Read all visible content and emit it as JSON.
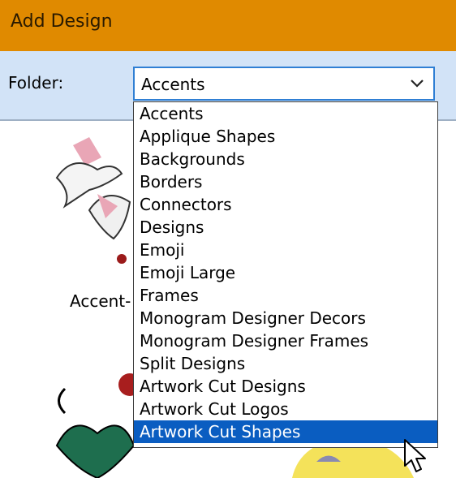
{
  "window": {
    "title": "Add Design"
  },
  "toolbar": {
    "folder_label": "Folder:"
  },
  "folder_select": {
    "value": "Accents",
    "options": [
      "Accents",
      "Applique Shapes",
      "Backgrounds",
      "Borders",
      "Connectors",
      "Designs",
      "Emoji",
      "Emoji Large",
      "Frames",
      "Monogram Designer Decors",
      "Monogram Designer Frames",
      "Split Designs",
      "Artwork Cut Designs",
      "Artwork Cut Logos",
      "Artwork Cut Shapes"
    ],
    "highlighted_index": 14
  },
  "gallery": {
    "first_item_label": "Accent-"
  },
  "colors": {
    "titlebar": "#e08a00",
    "toolbar": "#d2e3f7",
    "combo_border": "#2f7fd4",
    "highlight": "#0a5dc1"
  },
  "icons": {
    "dropdown": "chevron-down-icon",
    "cursor": "mouse-pointer-icon"
  }
}
